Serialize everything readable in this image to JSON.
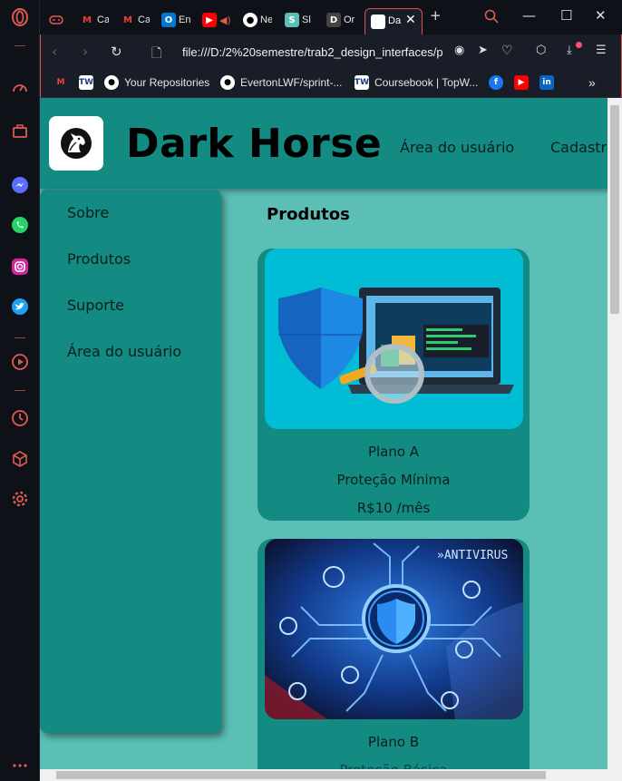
{
  "browser": {
    "tabs": [
      {
        "label": "Ca",
        "icon": "gmail-icon",
        "color": "#ea4335"
      },
      {
        "label": "Ca",
        "icon": "gmail-icon",
        "color": "#ea4335"
      },
      {
        "label": "En",
        "icon": "outlook-icon",
        "color": "#0078d4"
      },
      {
        "label": "",
        "icon": "youtube-icon",
        "color": "#ff0000"
      },
      {
        "label": "Ne",
        "icon": "github-icon",
        "color": "#ffffff"
      },
      {
        "label": "Sl",
        "icon": "slides-icon",
        "color": "#5bbfb6"
      },
      {
        "label": "Or",
        "icon": "d-icon",
        "color": "#444444"
      }
    ],
    "active_tab": {
      "label": "Da"
    },
    "url": "file:///D:/2%20semestre/trab2_design_interfaces/p",
    "bookmarks": [
      {
        "label": "",
        "icon": "gmail-icon"
      },
      {
        "label": "",
        "icon": "tw-icon"
      },
      {
        "label": "Your Repositories",
        "icon": "github-icon"
      },
      {
        "label": "EvertonLWF/sprint-...",
        "icon": "github-icon"
      },
      {
        "label": "Coursebook | TopW...",
        "icon": "tw-icon"
      },
      {
        "label": "",
        "icon": "facebook-icon"
      },
      {
        "label": "",
        "icon": "youtube-icon"
      },
      {
        "label": "",
        "icon": "linkedin-icon"
      }
    ],
    "more": "»"
  },
  "site": {
    "title": "Dark Horse",
    "nav": [
      "Área do usuário",
      "Cadastre"
    ],
    "menu": [
      "Sobre",
      "Produtos",
      "Suporte",
      "Área do usuário"
    ],
    "section_title": "Produtos",
    "products": [
      {
        "name": "Plano A",
        "desc": "Proteção Mínima",
        "price": "R$10 /mês"
      },
      {
        "name": "Plano B",
        "desc": "Proteção Básica",
        "price": ""
      }
    ],
    "antivirus_label": "»ANTIVIRUS",
    "colors": {
      "header": "#138b82",
      "page": "#5bbfb6",
      "card": "#138b82"
    }
  }
}
